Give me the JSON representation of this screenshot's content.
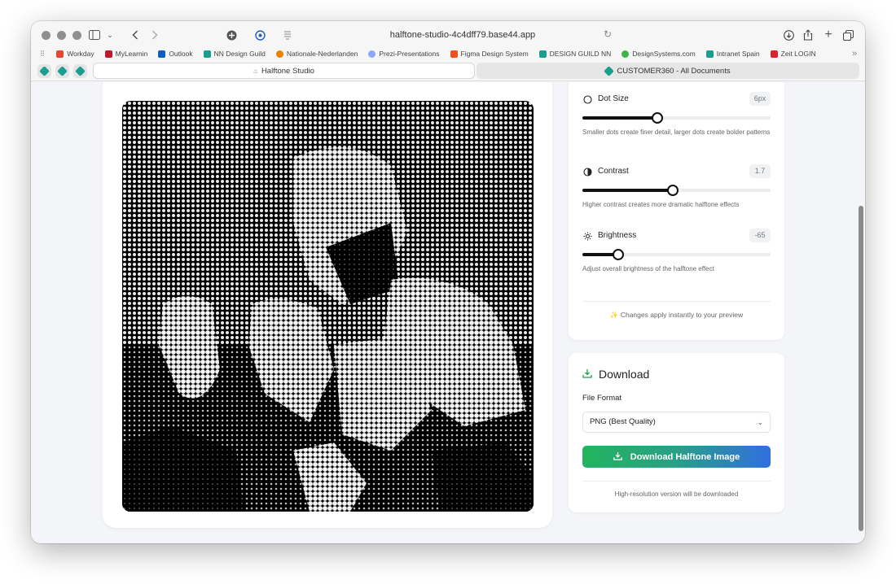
{
  "browser": {
    "url": "halftone-studio-4c4dff79.base44.app",
    "bookmarks": [
      {
        "label": "Workday",
        "color": "#e8472f"
      },
      {
        "label": "MyLearnin",
        "color": "#c0182c"
      },
      {
        "label": "Outlook",
        "color": "#0b5fbd"
      },
      {
        "label": "NN Design Guild",
        "color": "#1a9e8f"
      },
      {
        "label": "Nationale-Nederlanden",
        "color": "#ee7f00"
      },
      {
        "label": "Prezi-Presentations",
        "color": "#8ea6ff"
      },
      {
        "label": "Figma Design System",
        "color": "#f24e1e"
      },
      {
        "label": "DESIGN GUILD NN",
        "color": "#1a9e8f"
      },
      {
        "label": "DesignSystems.com",
        "color": "#3bb54a"
      },
      {
        "label": "Intranet Spain",
        "color": "#1a9e8f"
      },
      {
        "label": "Zeit LOGIN",
        "color": "#d9232e"
      }
    ],
    "tabs": {
      "active": "Halftone Studio",
      "other": "CUSTOMER360 - All Documents"
    }
  },
  "settings": {
    "dot_size": {
      "label": "Dot Size",
      "value": "6px",
      "level": 0.4,
      "description": "Smaller dots create finer detail, larger dots create bolder patterns"
    },
    "contrast": {
      "label": "Contrast",
      "value": "1.7",
      "level": 0.48,
      "description": "Higher contrast creates more dramatic halftone effects"
    },
    "brightness": {
      "label": "Brightness",
      "value": "-65",
      "level": 0.19,
      "description": "Adjust overall brightness of the halftone effect"
    },
    "note": "✨ Changes apply instantly to your preview"
  },
  "download": {
    "title": "Download",
    "file_format_label": "File Format",
    "file_format_value": "PNG (Best Quality)",
    "button_label": "Download Halftone Image",
    "note": "High-resolution version will be downloaded"
  },
  "icons": {
    "dot_size": "circle-icon",
    "contrast": "contrast-icon",
    "brightness": "sun-icon",
    "download": "download-icon"
  }
}
